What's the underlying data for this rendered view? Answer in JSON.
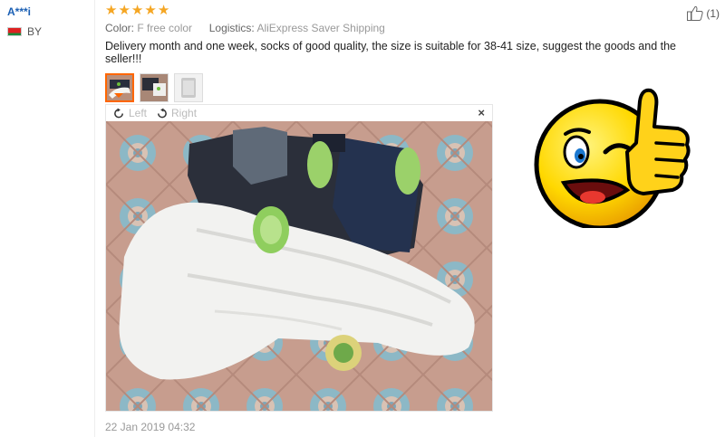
{
  "user": {
    "name": "A***i",
    "country": "BY"
  },
  "review": {
    "stars": 5,
    "color_label": "Color:",
    "color_value": "F free color",
    "logistics_label": "Logistics:",
    "logistics_value": "AliExpress Saver Shipping",
    "text": "Delivery month and one week, socks of good quality, the size is suitable for 38-41 size, suggest the goods and the seller!!!",
    "date": "22 Jan 2019 04:32",
    "likes": "(1)"
  },
  "viewer": {
    "rotate_left": "Left",
    "rotate_right": "Right",
    "close": "×"
  },
  "colors": {
    "star": "#f5a623",
    "accent": "#ff6600",
    "link": "#1a5fb4"
  },
  "icons": [
    "star-icon",
    "thumbs-up-icon",
    "rotate-left-icon",
    "rotate-right-icon",
    "close-icon",
    "flag-icon"
  ]
}
